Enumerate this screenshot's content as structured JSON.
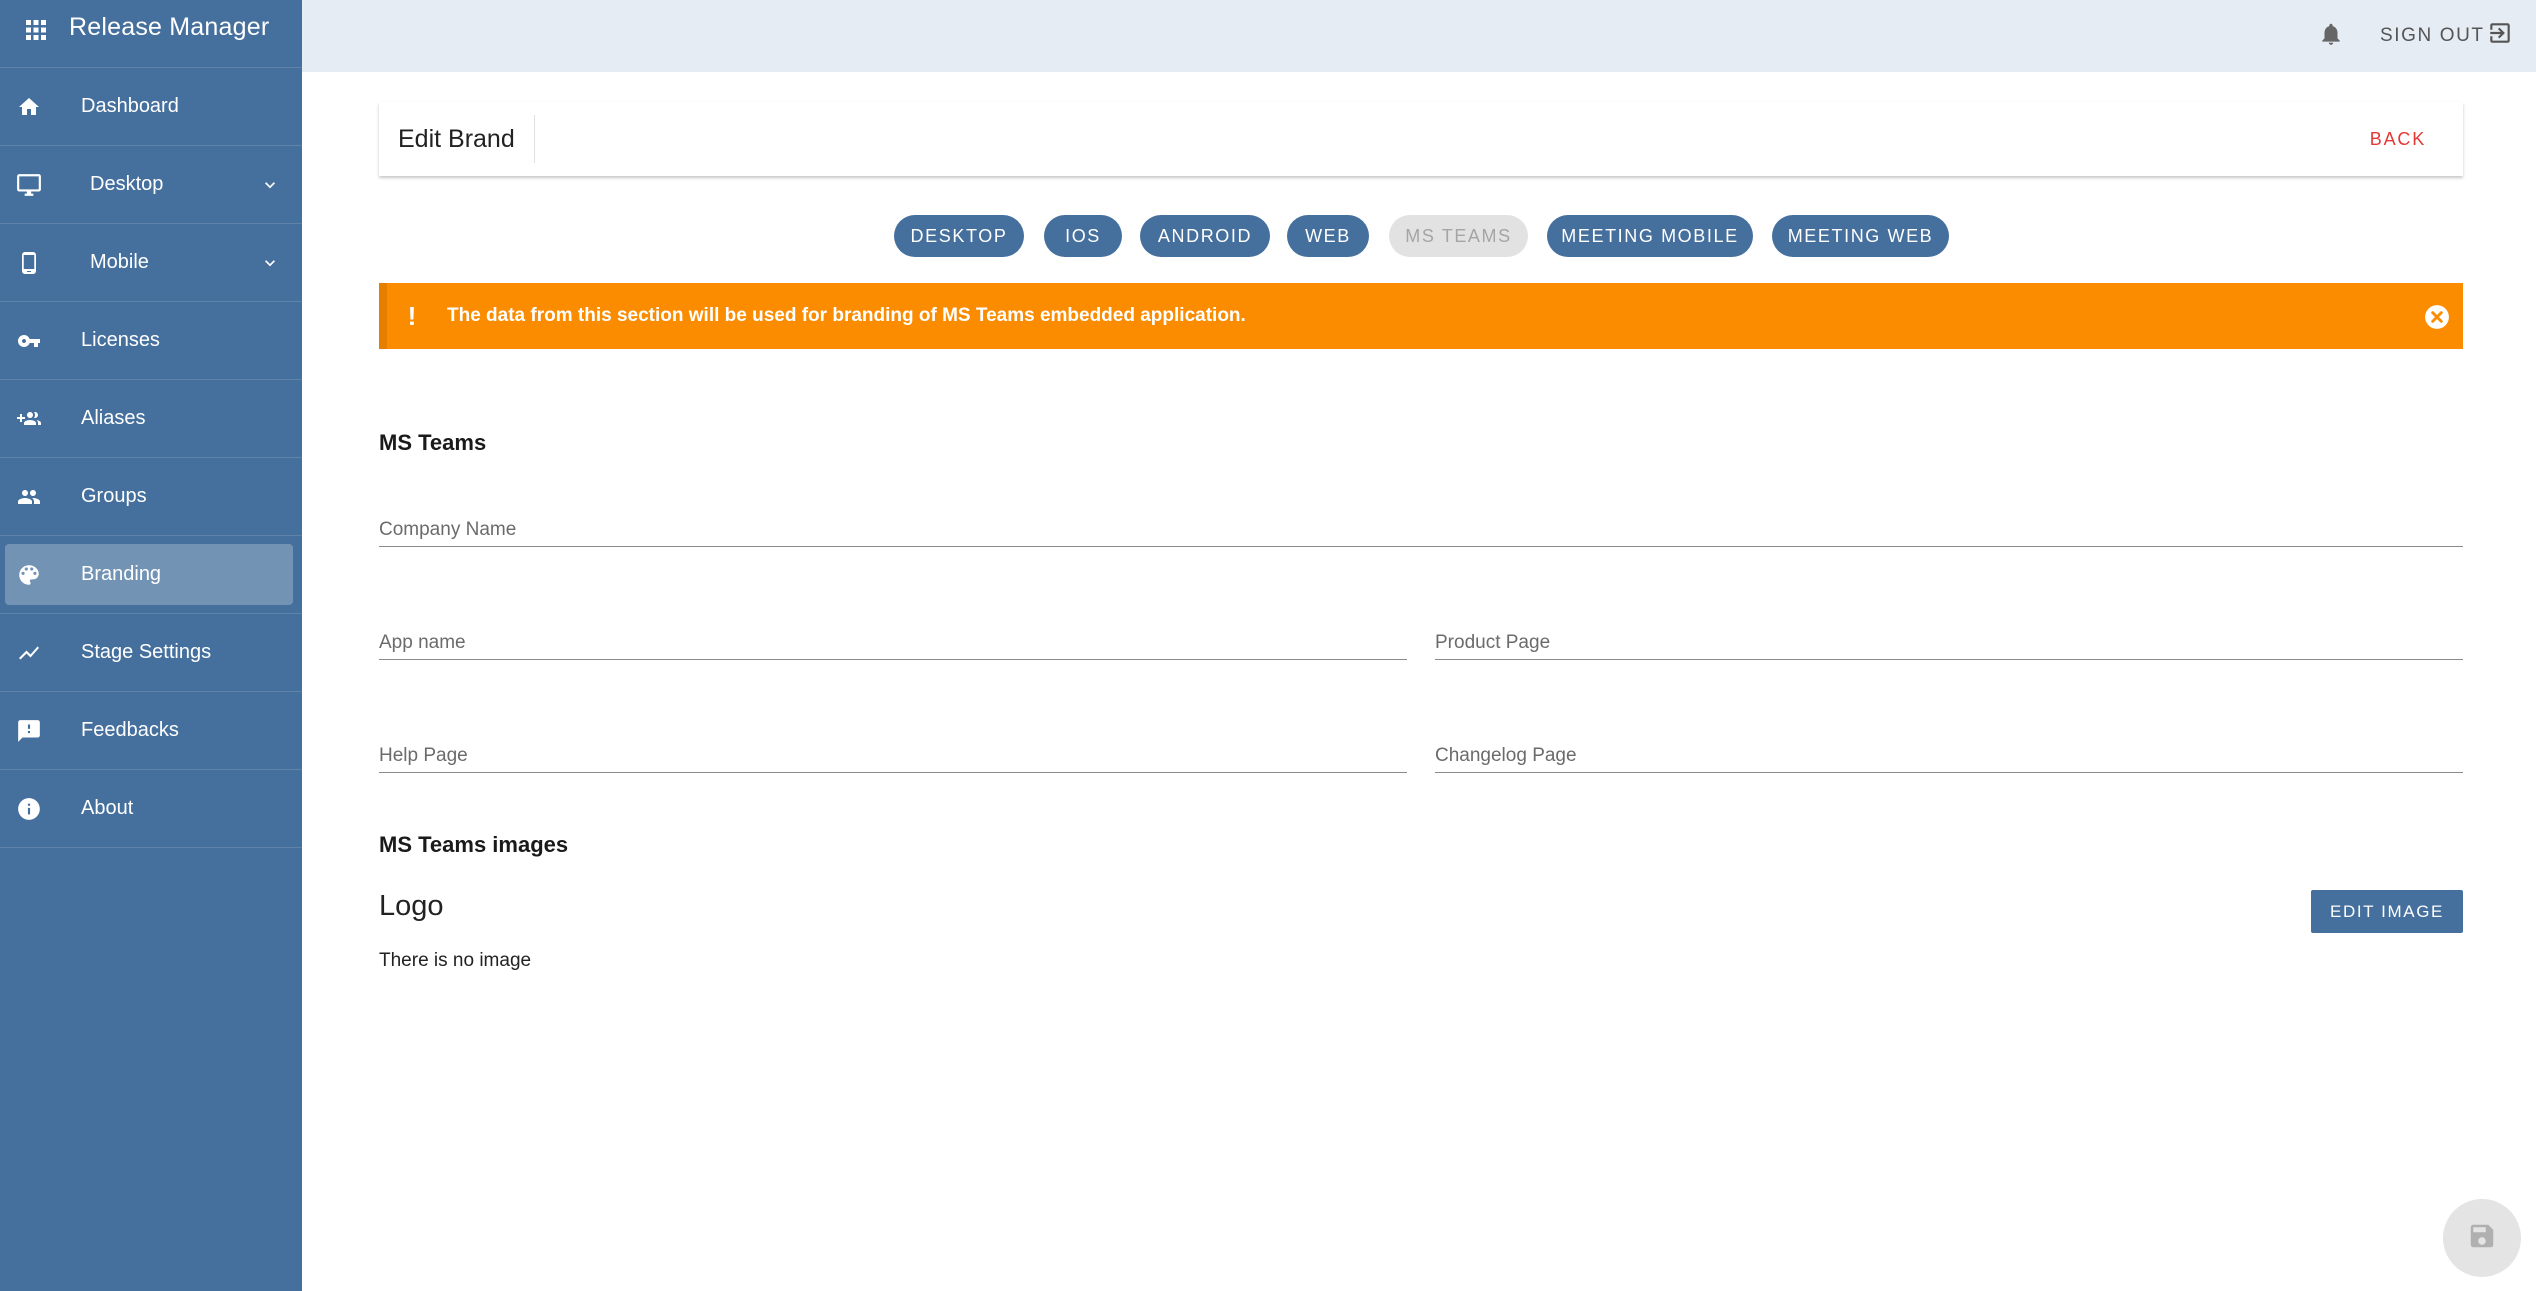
{
  "app": {
    "title": "Release Manager"
  },
  "sidebar": {
    "items": [
      {
        "label": "Dashboard"
      },
      {
        "label": "Desktop"
      },
      {
        "label": "Mobile"
      },
      {
        "label": "Licenses"
      },
      {
        "label": "Aliases"
      },
      {
        "label": "Groups"
      },
      {
        "label": "Branding"
      },
      {
        "label": "Stage Settings"
      },
      {
        "label": "Feedbacks"
      },
      {
        "label": "About"
      }
    ]
  },
  "topbar": {
    "signout_label": "SIGN OUT"
  },
  "header": {
    "title": "Edit Brand",
    "back_label": "BACK"
  },
  "tabs": [
    {
      "label": "DESKTOP"
    },
    {
      "label": "IOS"
    },
    {
      "label": "ANDROID"
    },
    {
      "label": "WEB"
    },
    {
      "label": "MS TEAMS"
    },
    {
      "label": "MEETING MOBILE"
    },
    {
      "label": "MEETING WEB"
    }
  ],
  "alert": {
    "message": "The data from this section will be used for branding of MS Teams embedded application."
  },
  "form": {
    "section_title": "MS Teams",
    "company_name": {
      "value": "",
      "placeholder": "Company Name"
    },
    "app_name": {
      "value": "",
      "placeholder": "App name"
    },
    "product_page": {
      "value": "",
      "placeholder": "Product Page"
    },
    "help_page": {
      "value": "",
      "placeholder": "Help Page"
    },
    "changelog_page": {
      "value": "",
      "placeholder": "Changelog Page"
    }
  },
  "images": {
    "section_title": "MS Teams images",
    "logo_label": "Logo",
    "no_image_text": "There is no image",
    "edit_label": "EDIT IMAGE"
  },
  "colors": {
    "primary": "#456f9d",
    "warning": "#fb8c00",
    "danger": "#e53935",
    "topbar": "#e6ecf3"
  }
}
